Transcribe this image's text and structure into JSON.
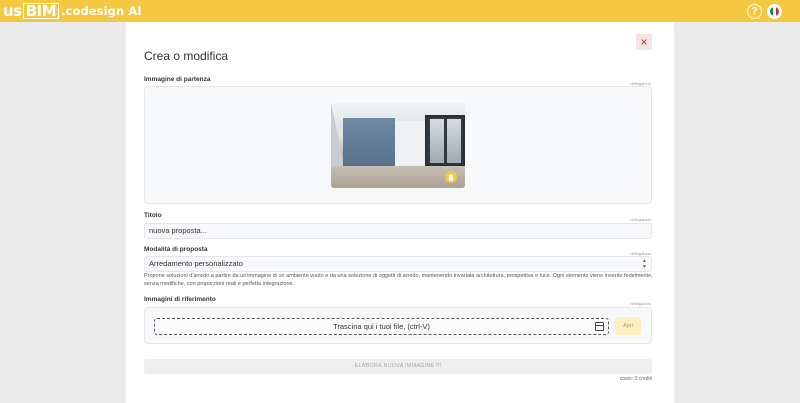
{
  "app": {
    "logo_us": "us",
    "logo_bim": "BIM",
    "logo_rest": ".codesign AI",
    "help_label": "?",
    "flag_colors": [
      "#009246",
      "#ffffff",
      "#ce2b37"
    ],
    "accent_color": "#f5c842"
  },
  "form": {
    "title": "Crea o modifica",
    "close_label": "×",
    "required_label": "obbligatorio",
    "start_image": {
      "label": "Immagine di partenza",
      "delete_icon": "trash-icon"
    },
    "name_field": {
      "label": "Titolo",
      "value": "nuova proposta..."
    },
    "mode_field": {
      "label": "Modalità di proposta",
      "value": "Arredamento personalizzato",
      "description": "Propone soluzioni d'arredo a partire da un'immagine di un ambiente vuoto e da una selezione di oggetti di arredo, mantenendo invariata architettura, prospettiva e luce. Ogni elemento viene inserito fedelmente, senza modifiche, con proporzioni reali e perfetta integrazione."
    },
    "references": {
      "label": "Immagini di riferimento",
      "dropzone_text": "Trascina qui i tuoi file, (ctrl-V)",
      "open_label": "Apri"
    },
    "submit_label": "ELABORA NUOVA IMMAGINE !!!",
    "cost_text": "costo: 3 crediti"
  }
}
